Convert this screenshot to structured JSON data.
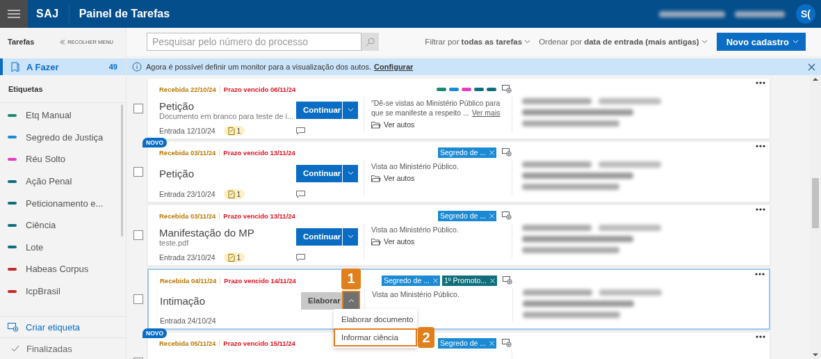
{
  "header": {
    "logo": "SAJ",
    "title": "Painel de Tarefas",
    "avatar": "S("
  },
  "sidebar": {
    "heading": "Tarefas",
    "collapse": "RECOLHER MENU",
    "todo": {
      "label": "A Fazer",
      "count": "49",
      "selected": true
    },
    "labels_heading": "Etiquetas",
    "labels": [
      {
        "name": "Etq Manual",
        "color": "#1a8a72"
      },
      {
        "name": "Segredo de Justiça",
        "color": "#1a8ad4"
      },
      {
        "name": "Réu Solto",
        "color": "#e83bbd"
      },
      {
        "name": "Ação Penal",
        "color": "#0f6e7a"
      },
      {
        "name": "Peticionamento e...",
        "color": "#0f6e7a"
      },
      {
        "name": "Ciência",
        "color": "#0f6e7a"
      },
      {
        "name": "Lote",
        "color": "#0f6e7a"
      },
      {
        "name": "Habeas Corpus",
        "color": "#c62828"
      },
      {
        "name": "IcpBrasil",
        "color": "#c62828"
      }
    ],
    "create": "Criar etiqueta",
    "done": "Finalizadas"
  },
  "toolbar": {
    "search": {
      "placeholder": "Pesquisar pelo número do processo"
    },
    "filter": {
      "prefix": "Filtrar por",
      "value": "todas as tarefas"
    },
    "sort": {
      "prefix": "Ordenar por",
      "value": "data de entrada (mais antigas)"
    },
    "new_button": "Novo cadastro"
  },
  "banner": {
    "text": "Agora é possível definir um monitor para a visualização dos autos.",
    "link": "Configurar"
  },
  "tasks": [
    {
      "new": false,
      "checked": false,
      "selected": false,
      "received": "Recebida 22/10/24",
      "deadline": "Prazo vencido 06/11/24",
      "tag_stripes": [
        {
          "color": "#1a8a72"
        },
        {
          "color": "#1a8ad4"
        },
        {
          "color": "#e83bbd"
        },
        {
          "color": "#0f6e7a"
        },
        {
          "color": "#0f6e7a"
        }
      ],
      "title": "Petição",
      "subtitle": "Documento em branco para teste de i...",
      "action": {
        "label": "Continuar",
        "kind": "primary",
        "expanded": false
      },
      "entry": "Entrada 12/10/24",
      "docs": "1",
      "description": "\"Dê-se vistas ao Ministério Público para que se manifeste a respeito ...",
      "more": "Ver mais",
      "autos": "Ver autos"
    },
    {
      "new": true,
      "badge": "NOVO",
      "checked": false,
      "selected": false,
      "received": "Recebida 03/11/24",
      "deadline": "Prazo vencido 13/11/24",
      "tags": [
        {
          "label": "Segredo de ...",
          "color": "#1a8ad4"
        }
      ],
      "title": "Petição",
      "action": {
        "label": "Continuar",
        "kind": "primary",
        "expanded": false
      },
      "entry": "Entrada 23/10/24",
      "docs": "1",
      "description": "Vista ao Ministério Público.",
      "autos": "Ver autos"
    },
    {
      "new": false,
      "checked": false,
      "selected": false,
      "received": "Recebida 03/11/24",
      "deadline": "Prazo vencido 13/11/24",
      "tags": [
        {
          "label": "Segredo de ...",
          "color": "#1a8ad4"
        }
      ],
      "title": "Manifestação do MP",
      "subtitle": "teste.pdf",
      "action": {
        "label": "Continuar",
        "kind": "primary",
        "expanded": false
      },
      "entry": "Entrada 23/10/24",
      "docs": "1",
      "description": "Vista ao Ministério Público.",
      "autos": "Ver autos"
    },
    {
      "new": false,
      "checked": false,
      "selected": true,
      "received": "Recebida 04/11/24",
      "deadline": "Prazo vencido 14/11/24",
      "tags": [
        {
          "label": "Segredo de ...",
          "color": "#1a8ad4"
        },
        {
          "label": "1º Promoto...",
          "color": "#0f6e7a"
        }
      ],
      "title": "Intimação",
      "action": {
        "label": "Elaborar",
        "kind": "secondary",
        "expanded": true,
        "callout": "1"
      },
      "entry": "Entrada 24/10/24",
      "description": "Vista ao Ministério Público.",
      "menu": [
        {
          "label": "Elaborar documento",
          "selected": false
        },
        {
          "label": "Informar ciência",
          "selected": true,
          "callout": "2"
        }
      ]
    },
    {
      "new": true,
      "badge": "NOVO",
      "checked": false,
      "selected": false,
      "received": "Recebida 05/11/24",
      "deadline": "Prazo vencido 15/11/24",
      "tags": [
        {
          "label": "Segredo de ...",
          "color": "#1a8ad4"
        }
      ]
    }
  ]
}
